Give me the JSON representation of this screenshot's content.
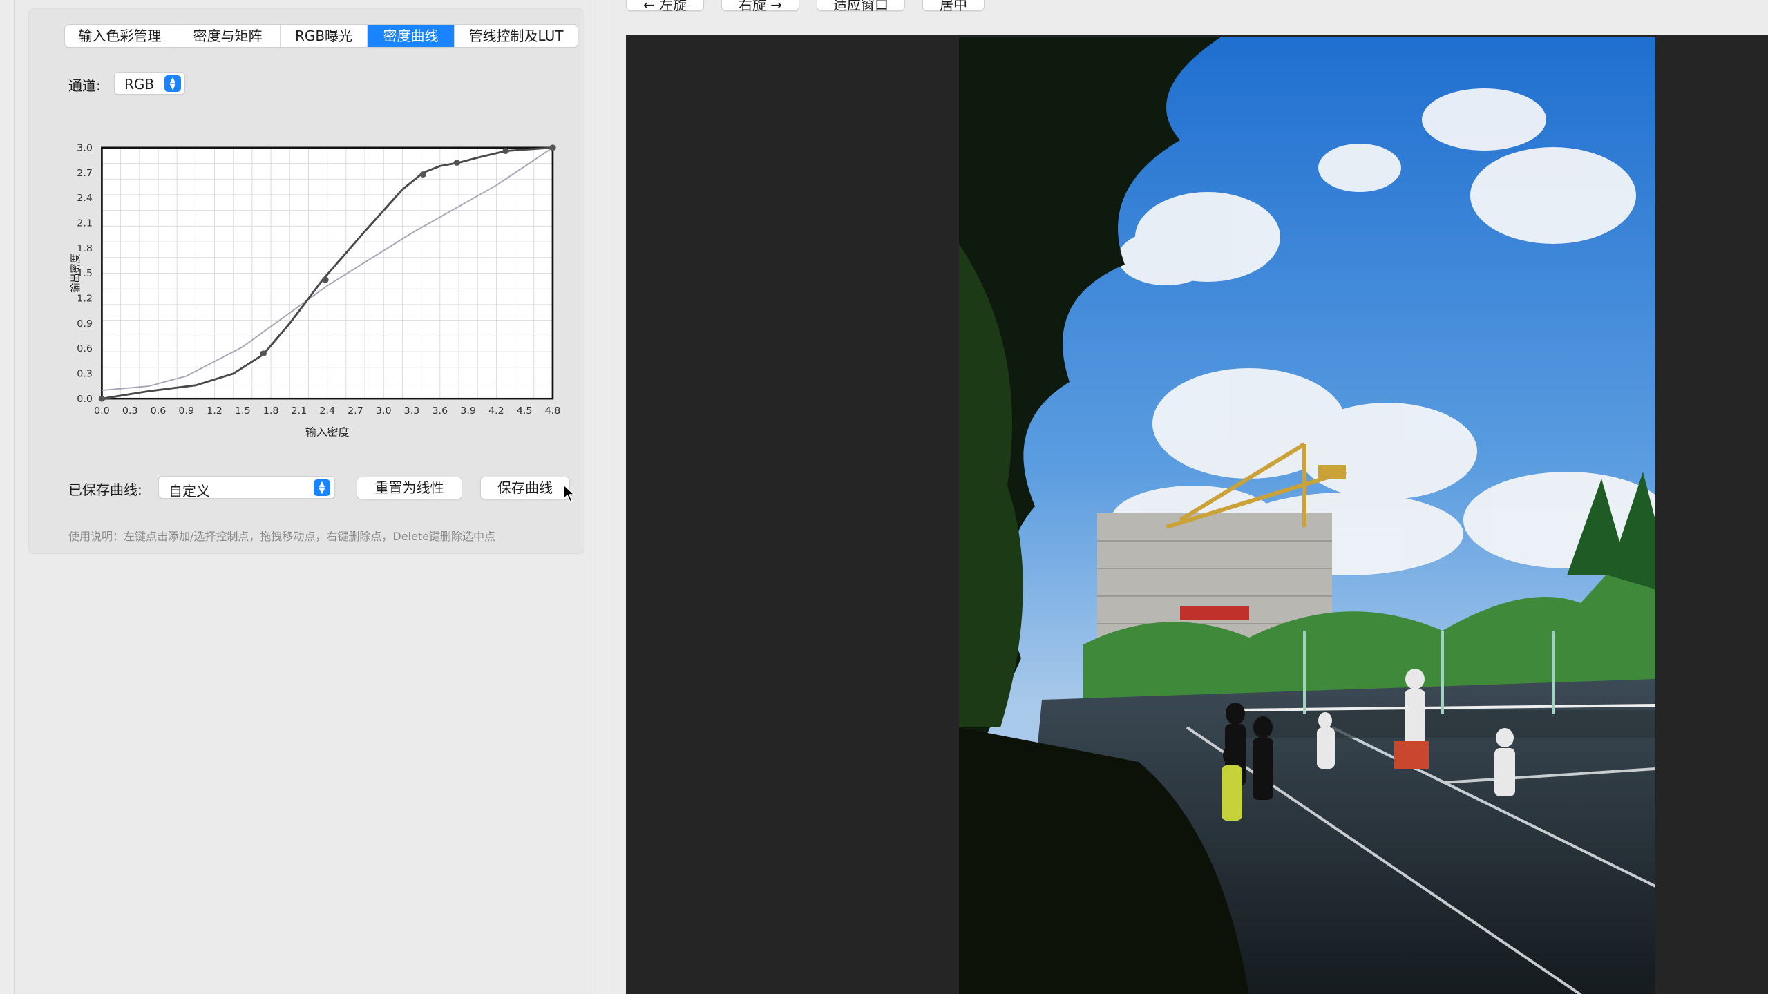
{
  "tabs": [
    {
      "label": "输入色彩管理",
      "active": false
    },
    {
      "label": "密度与矩阵",
      "active": false
    },
    {
      "label": "RGB曝光",
      "active": false
    },
    {
      "label": "密度曲线",
      "active": true
    },
    {
      "label": "管线控制及LUT",
      "active": false
    }
  ],
  "channel": {
    "label": "通道:",
    "value": "RGB"
  },
  "chart_data": {
    "type": "line",
    "xlabel": "输入密度",
    "ylabel": "输出密度",
    "xlim": [
      0,
      4.8
    ],
    "ylim": [
      0,
      3.0
    ],
    "xticks": [
      "0.0",
      "0.3",
      "0.6",
      "0.9",
      "1.2",
      "1.5",
      "1.8",
      "2.1",
      "2.4",
      "2.7",
      "3.0",
      "3.3",
      "3.6",
      "3.9",
      "4.2",
      "4.5",
      "4.8"
    ],
    "yticks": [
      "0.0",
      "0.3",
      "0.6",
      "0.9",
      "1.2",
      "1.5",
      "1.8",
      "2.1",
      "2.4",
      "2.7",
      "3.0"
    ],
    "grid": true,
    "series": [
      {
        "role": "reference-linear",
        "x": [
          0,
          0.5,
          0.9,
          1.5,
          2.4,
          3.3,
          4.2,
          4.8
        ],
        "y": [
          0.1,
          0.15,
          0.27,
          0.62,
          1.35,
          1.98,
          2.55,
          3.0
        ]
      },
      {
        "role": "curve",
        "x": [
          0,
          0.5,
          1.0,
          1.4,
          1.72,
          2.0,
          2.35,
          2.8,
          3.2,
          3.42,
          3.6,
          3.8,
          4.0,
          4.3,
          4.8
        ],
        "y": [
          0.0,
          0.09,
          0.16,
          0.3,
          0.53,
          0.9,
          1.42,
          2.0,
          2.5,
          2.7,
          2.78,
          2.82,
          2.88,
          2.96,
          3.0
        ]
      }
    ],
    "control_points": {
      "x": [
        0,
        1.72,
        2.38,
        3.42,
        3.78,
        4.3,
        4.8
      ],
      "y": [
        0.0,
        0.54,
        1.42,
        2.68,
        2.82,
        2.96,
        3.0
      ]
    }
  },
  "saved_curve": {
    "label": "已保存曲线:",
    "value": "自定义"
  },
  "buttons": {
    "reset": "重置为线性",
    "save": "保存曲线"
  },
  "usage": "使用说明：左键点击添加/选择控制点，拖拽移动点，右键删除点，Delete键删除选中点",
  "toolbar": {
    "rotate_left": "← 左旋",
    "rotate_right": "右旋 →",
    "fit_window": "适应窗口",
    "center": "居中"
  },
  "colors": {
    "accent": "#1a84ff",
    "viewer_bg": "#252525"
  }
}
